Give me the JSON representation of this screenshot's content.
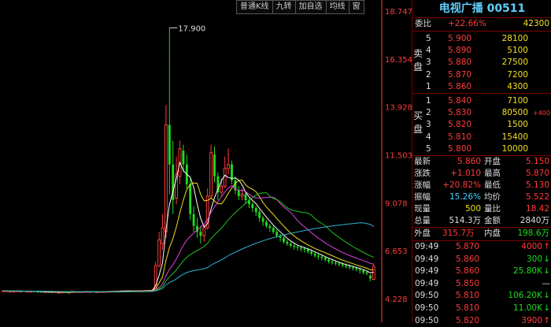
{
  "colors": {
    "up": "#ff3c3c",
    "down": "#20dc20",
    "axis": "#ff3c3c",
    "ma5": "#ffffff",
    "ma10": "#f0e020",
    "ma20": "#e040e0",
    "ma30": "#20c020",
    "ma60": "#30b0d0"
  },
  "toolbar": [
    "普通K线",
    "九转",
    "加自选",
    "均线",
    "窗"
  ],
  "stock": {
    "title": "电视广播 00511"
  },
  "chart_data": {
    "type": "candlestick",
    "y_ticks": [
      "18.747",
      "16.354",
      "13.928",
      "11.503",
      "9.078",
      "6.653",
      "4.228"
    ],
    "ylim": [
      4.228,
      18.747
    ],
    "peak_annotation": "17.900",
    "candles": [
      [
        4.58,
        4.62,
        4.62,
        4.56
      ],
      [
        4.6,
        4.62,
        4.65,
        4.57
      ],
      [
        4.58,
        4.6,
        4.64,
        4.56
      ],
      [
        4.6,
        4.6,
        4.62,
        4.57
      ],
      [
        4.58,
        4.62,
        4.64,
        4.56
      ],
      [
        4.6,
        4.6,
        4.62,
        4.57
      ],
      [
        4.61,
        4.58,
        4.63,
        4.56
      ],
      [
        4.59,
        4.6,
        4.62,
        4.57
      ],
      [
        4.57,
        4.6,
        4.62,
        4.55
      ],
      [
        4.6,
        4.58,
        4.62,
        4.56
      ],
      [
        4.58,
        4.56,
        4.6,
        4.53
      ],
      [
        4.57,
        4.56,
        4.59,
        4.54
      ],
      [
        4.56,
        4.57,
        4.59,
        4.53
      ],
      [
        4.56,
        4.55,
        4.58,
        4.52
      ],
      [
        4.55,
        4.57,
        4.59,
        4.53
      ],
      [
        4.56,
        4.55,
        4.58,
        4.53
      ],
      [
        4.55,
        4.55,
        4.57,
        4.52
      ],
      [
        4.54,
        4.56,
        4.58,
        4.52
      ],
      [
        4.55,
        4.54,
        4.57,
        4.52
      ],
      [
        4.54,
        4.55,
        4.57,
        4.52
      ],
      [
        4.55,
        4.6,
        4.62,
        4.53
      ],
      [
        4.58,
        4.58,
        4.61,
        4.55
      ],
      [
        4.57,
        4.58,
        4.6,
        4.55
      ],
      [
        4.58,
        4.58,
        4.6,
        4.56
      ],
      [
        4.58,
        4.59,
        4.62,
        4.56
      ],
      [
        4.58,
        4.58,
        4.6,
        4.56
      ],
      [
        4.58,
        4.57,
        4.6,
        4.55
      ],
      [
        4.57,
        4.57,
        4.6,
        4.55
      ],
      [
        4.57,
        4.58,
        4.6,
        4.55
      ],
      [
        4.58,
        4.58,
        4.61,
        4.56
      ],
      [
        4.58,
        4.59,
        4.61,
        4.56
      ],
      [
        4.6,
        4.6,
        4.63,
        4.57
      ],
      [
        4.6,
        4.6,
        4.63,
        4.58
      ],
      [
        4.6,
        4.6,
        4.62,
        4.58
      ],
      [
        4.6,
        4.62,
        4.64,
        4.58
      ],
      [
        4.62,
        4.62,
        4.65,
        4.6
      ],
      [
        4.62,
        4.62,
        4.66,
        4.6
      ],
      [
        4.62,
        4.6,
        4.65,
        4.58
      ],
      [
        4.6,
        4.62,
        4.64,
        4.58
      ],
      [
        4.62,
        4.62,
        4.65,
        4.6
      ],
      [
        4.62,
        4.62,
        4.65,
        4.6
      ],
      [
        4.62,
        4.63,
        4.66,
        4.6
      ],
      [
        4.63,
        4.64,
        4.67,
        4.6
      ],
      [
        4.64,
        4.65,
        4.68,
        4.62
      ],
      [
        4.65,
        5.9,
        6.1,
        4.65
      ],
      [
        5.9,
        7.2,
        7.6,
        5.8
      ],
      [
        7.0,
        7.8,
        8.5,
        6.7
      ],
      [
        7.6,
        13.0,
        14.0,
        7.3
      ],
      [
        13.0,
        11.0,
        17.9,
        9.5
      ],
      [
        11.0,
        9.2,
        12.2,
        8.5
      ],
      [
        9.3,
        10.5,
        11.4,
        9.0
      ],
      [
        10.4,
        11.8,
        12.2,
        10.0
      ],
      [
        11.7,
        11.0,
        12.0,
        10.6
      ],
      [
        11.0,
        10.0,
        11.5,
        9.8
      ],
      [
        10.0,
        8.5,
        10.3,
        8.2
      ],
      [
        8.5,
        7.9,
        8.9,
        7.6
      ],
      [
        7.9,
        7.6,
        8.3,
        7.3
      ],
      [
        7.6,
        7.4,
        7.9,
        7.0
      ],
      [
        7.4,
        7.8,
        8.0,
        7.1
      ],
      [
        7.8,
        9.4,
        9.8,
        7.7
      ],
      [
        9.4,
        11.6,
        12.0,
        9.3
      ],
      [
        11.5,
        10.4,
        11.9,
        10.1
      ],
      [
        10.4,
        9.6,
        10.6,
        9.2
      ],
      [
        9.6,
        9.9,
        10.3,
        9.4
      ],
      [
        9.9,
        10.8,
        11.4,
        9.8
      ],
      [
        10.8,
        11.0,
        11.8,
        10.5
      ],
      [
        11.0,
        10.2,
        11.2,
        10.0
      ],
      [
        10.2,
        9.7,
        10.4,
        9.5
      ],
      [
        9.7,
        9.4,
        9.9,
        9.2
      ],
      [
        9.4,
        9.5,
        9.8,
        9.2
      ],
      [
        9.5,
        9.2,
        9.6,
        9.0
      ],
      [
        9.2,
        9.0,
        9.3,
        8.8
      ],
      [
        9.0,
        8.8,
        9.1,
        8.6
      ],
      [
        8.8,
        8.6,
        8.9,
        8.4
      ],
      [
        8.6,
        8.3,
        8.7,
        8.1
      ],
      [
        8.3,
        8.1,
        8.4,
        7.9
      ],
      [
        8.1,
        7.9,
        8.2,
        7.8
      ],
      [
        7.9,
        7.8,
        8.0,
        7.6
      ],
      [
        7.8,
        7.6,
        7.9,
        7.5
      ],
      [
        7.6,
        7.4,
        7.7,
        7.3
      ],
      [
        7.4,
        7.3,
        7.5,
        7.1
      ],
      [
        7.3,
        7.1,
        7.4,
        7.0
      ],
      [
        7.1,
        7.0,
        7.2,
        6.9
      ],
      [
        7.0,
        6.9,
        7.1,
        6.8
      ],
      [
        6.9,
        6.85,
        7.0,
        6.7
      ],
      [
        6.85,
        6.8,
        6.95,
        6.65
      ],
      [
        6.8,
        6.75,
        6.9,
        6.6
      ],
      [
        6.75,
        6.7,
        6.85,
        6.55
      ],
      [
        6.7,
        6.6,
        6.8,
        6.5
      ],
      [
        6.6,
        6.5,
        6.7,
        6.4
      ],
      [
        6.5,
        6.4,
        6.6,
        6.3
      ],
      [
        6.4,
        6.35,
        6.5,
        6.2
      ],
      [
        6.35,
        6.3,
        6.45,
        6.15
      ],
      [
        6.3,
        6.2,
        6.35,
        6.1
      ],
      [
        6.2,
        6.1,
        6.3,
        6.0
      ],
      [
        6.1,
        6.05,
        6.2,
        5.95
      ],
      [
        6.05,
        6.0,
        6.15,
        5.9
      ],
      [
        6.0,
        5.95,
        6.1,
        5.85
      ],
      [
        5.95,
        5.9,
        6.05,
        5.8
      ],
      [
        5.9,
        5.85,
        6.0,
        5.75
      ],
      [
        5.85,
        5.8,
        5.95,
        5.7
      ],
      [
        5.8,
        5.75,
        5.9,
        5.65
      ],
      [
        5.75,
        5.7,
        5.85,
        5.6
      ],
      [
        5.7,
        5.65,
        5.8,
        5.5
      ],
      [
        5.65,
        5.55,
        5.7,
        5.45
      ],
      [
        5.55,
        5.5,
        5.6,
        5.4
      ],
      [
        5.4,
        5.25,
        5.45,
        5.1
      ],
      [
        5.2,
        5.86,
        6.0,
        5.15
      ]
    ]
  },
  "panel": {
    "weibi": {
      "label": "委比",
      "pct": "+22.66%",
      "vol": "42300"
    },
    "sell_label": "卖盘",
    "sells": [
      {
        "lvl": "5",
        "price": "5.900",
        "vol": "28100"
      },
      {
        "lvl": "4",
        "price": "5.890",
        "vol": "5100"
      },
      {
        "lvl": "3",
        "price": "5.880",
        "vol": "27500"
      },
      {
        "lvl": "2",
        "price": "5.870",
        "vol": "7200"
      },
      {
        "lvl": "1",
        "price": "5.860",
        "vol": "4300"
      }
    ],
    "buy_label": "买盘",
    "buys": [
      {
        "lvl": "1",
        "price": "5.840",
        "vol": "7100",
        "chg": ""
      },
      {
        "lvl": "2",
        "price": "5.830",
        "vol": "80500",
        "chg": "+400"
      },
      {
        "lvl": "3",
        "price": "5.820",
        "vol": "1500",
        "chg": ""
      },
      {
        "lvl": "4",
        "price": "5.810",
        "vol": "15400",
        "chg": ""
      },
      {
        "lvl": "5",
        "price": "5.800",
        "vol": "10000",
        "chg": ""
      }
    ],
    "stats": [
      [
        {
          "k": "最新",
          "v": "5.860",
          "c": "r"
        },
        {
          "k": "开盘",
          "v": "5.150",
          "c": "r"
        }
      ],
      [
        {
          "k": "涨跌",
          "v": "+1.010",
          "c": "r"
        },
        {
          "k": "最高",
          "v": "5.870",
          "c": "r"
        }
      ],
      [
        {
          "k": "涨幅",
          "v": "+20.82%",
          "c": "r"
        },
        {
          "k": "最低",
          "v": "5.130",
          "c": "r"
        }
      ],
      [
        {
          "k": "振幅",
          "v": "15.26%",
          "c": "c"
        },
        {
          "k": "均价",
          "v": "5.522",
          "c": "r"
        }
      ],
      [
        {
          "k": "现量",
          "v": "500",
          "c": "y"
        },
        {
          "k": "量比",
          "v": "18.42",
          "c": "r"
        }
      ],
      [
        {
          "k": "总量",
          "v": "514.3万",
          "c": "w"
        },
        {
          "k": "金额",
          "v": "2840万",
          "c": "w"
        }
      ]
    ],
    "waipan": {
      "label": "外盘",
      "value": "315.7万",
      "label2": "内盘",
      "value2": "198.6万"
    },
    "ticks": [
      {
        "time": "09:49",
        "price": "5.870",
        "vol": "4000",
        "dir": "up"
      },
      {
        "time": "09:49",
        "price": "5.860",
        "vol": "300",
        "dir": "down"
      },
      {
        "time": "09:49",
        "price": "5.860",
        "vol": "25.80K",
        "dir": "down"
      },
      {
        "time": "09:49",
        "price": "5.850",
        "vol": "",
        "dir": "flat"
      },
      {
        "time": "09:50",
        "price": "5.810",
        "vol": "106.20K",
        "dir": "down"
      },
      {
        "time": "09:50",
        "price": "5.810",
        "vol": "11.00K",
        "dir": "down"
      },
      {
        "time": "09:50",
        "price": "5.820",
        "vol": "3900",
        "dir": "up"
      }
    ]
  }
}
